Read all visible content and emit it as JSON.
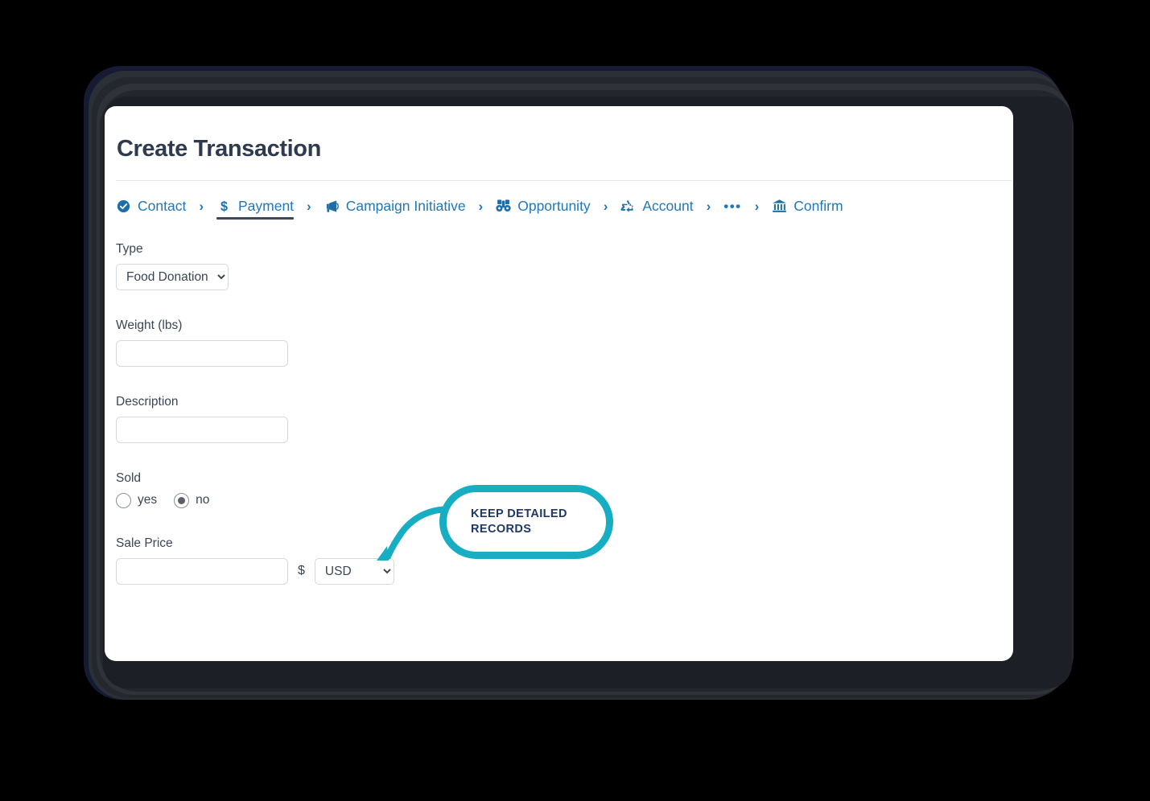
{
  "window": {
    "title": "Create Transaction"
  },
  "stepper": {
    "steps": [
      {
        "label": "Contact",
        "icon": "check-circle-icon",
        "state": "completed"
      },
      {
        "label": "Payment",
        "icon": "dollar-icon",
        "state": "active"
      },
      {
        "label": "Campaign Initiative",
        "icon": "megaphone-icon",
        "state": "upcoming"
      },
      {
        "label": "Opportunity",
        "icon": "binoculars-icon",
        "state": "upcoming"
      },
      {
        "label": "Account",
        "icon": "recycle-icon",
        "state": "upcoming"
      },
      {
        "label": "•••",
        "icon": "ellipsis-icon",
        "state": "overflow"
      },
      {
        "label": "Confirm",
        "icon": "bank-icon",
        "state": "upcoming"
      }
    ],
    "separator": "›"
  },
  "form": {
    "type": {
      "label": "Type",
      "value": "Food Donation",
      "options": [
        "Food Donation"
      ]
    },
    "weight": {
      "label": "Weight (lbs)",
      "value": "",
      "placeholder": ""
    },
    "description": {
      "label": "Description",
      "value": "",
      "placeholder": ""
    },
    "sold": {
      "label": "Sold",
      "options": [
        {
          "label": "yes",
          "selected": false
        },
        {
          "label": "no",
          "selected": true
        }
      ]
    },
    "sale_price": {
      "label": "Sale Price",
      "value": "",
      "placeholder": "",
      "currency_symbol": "$",
      "currency": "USD",
      "currency_options": [
        "USD"
      ]
    }
  },
  "callout": {
    "line1": "KEEP DETAILED",
    "line2": "RECORDS",
    "accent_color": "#17aec3",
    "text_color": "#1f3864"
  },
  "theme": {
    "background": "#000000",
    "panel": "#ffffff",
    "link_blue": "#2277bb",
    "title_color": "#2e3a4d",
    "label_color": "#3b4654",
    "border_color": "#d5d9de"
  }
}
